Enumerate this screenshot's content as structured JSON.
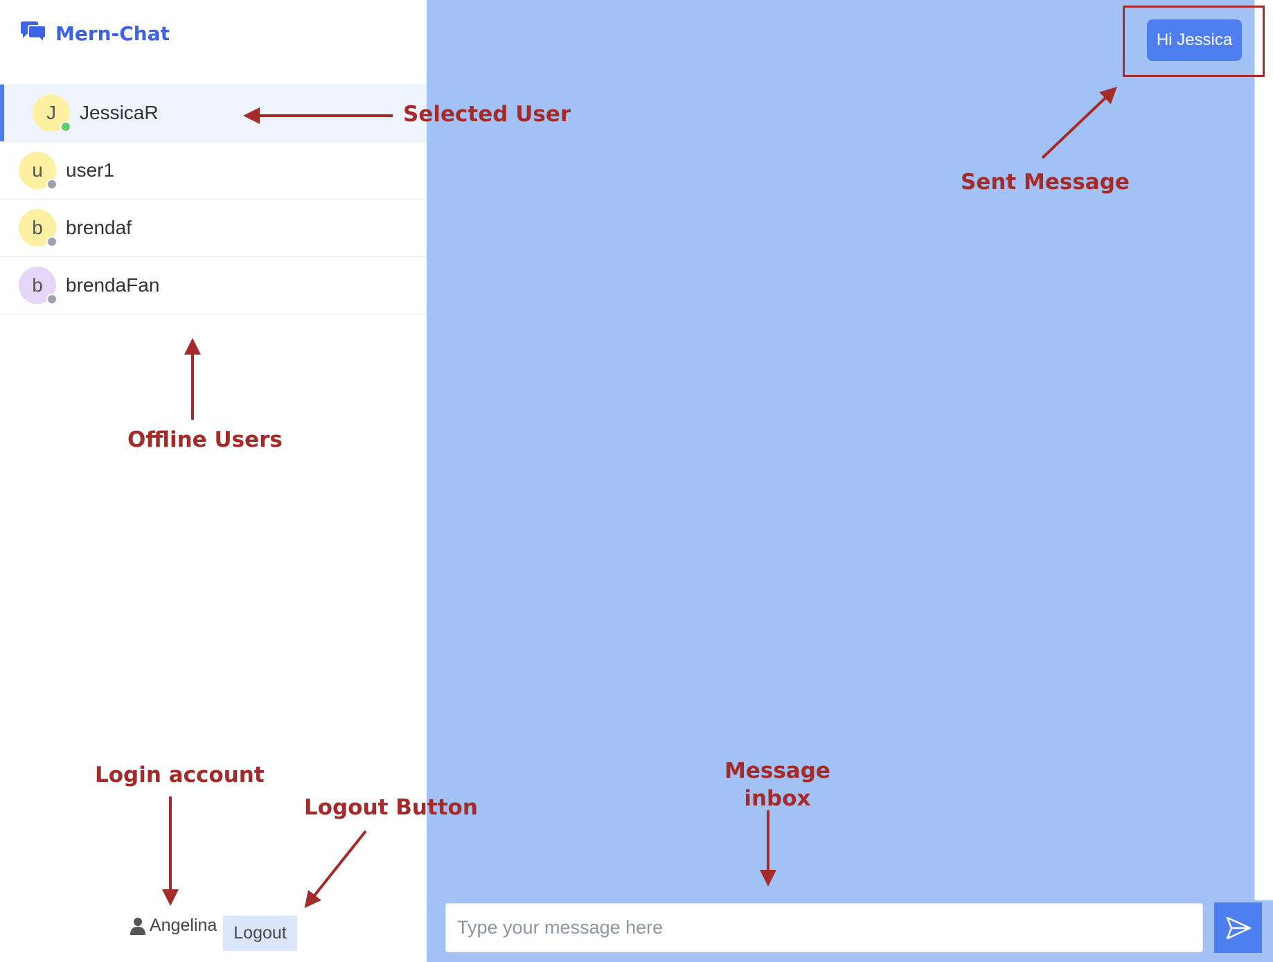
{
  "app": {
    "title": "Mern-Chat"
  },
  "contacts": [
    {
      "name": "JessicaR",
      "initial": "J",
      "avatar_color": "#fdf0a2",
      "status_color": "#5bd06a",
      "selected": true
    },
    {
      "name": "user1",
      "initial": "u",
      "avatar_color": "#fdf0a2",
      "status_color": "#9ca3af",
      "selected": false
    },
    {
      "name": "brendaf",
      "initial": "b",
      "avatar_color": "#fdf0a2",
      "status_color": "#9ca3af",
      "selected": false
    },
    {
      "name": "brendaFan",
      "initial": "b",
      "avatar_color": "#e5d6f7",
      "status_color": "#9ca3af",
      "selected": false
    }
  ],
  "account": {
    "username": "Angelina",
    "logout_label": "Logout"
  },
  "chat": {
    "messages": [
      {
        "text": "Hi Jessica",
        "direction": "sent"
      }
    ],
    "input_placeholder": "Type your message here"
  },
  "annotations": {
    "selected_user": "Selected User",
    "sent_message": "Sent Message",
    "offline_users": "Offline Users",
    "login_account": "Login account",
    "logout_button": "Logout Button",
    "message_inbox_line1": "Message",
    "message_inbox_line2": "inbox",
    "color": "#a52a2a"
  },
  "colors": {
    "accent": "#4e7ff1",
    "chat_background": "#a2c2f5",
    "brand": "#3b63e6"
  }
}
